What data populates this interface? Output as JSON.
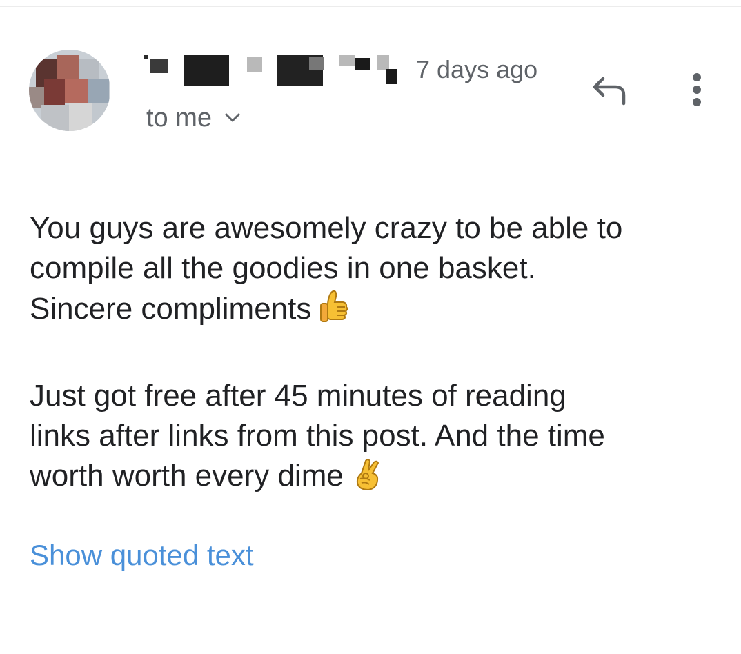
{
  "message": {
    "sender_name": "",
    "timestamp": "7 days ago",
    "recipient_label": "to me",
    "body_paragraphs": [
      {
        "lines": [
          "You guys are awesomely crazy to be able to",
          "compile all the goodies in one basket.",
          "Sincere compliments"
        ],
        "trailing_emoji": "thumbs-up-emoji"
      },
      {
        "lines": [
          "Just got free after 45 minutes of reading",
          "links after links from this post. And the time",
          "worth worth every dime"
        ],
        "trailing_emoji": "crossed-fingers-emoji"
      }
    ],
    "show_quoted_label": "Show quoted text"
  },
  "icons": {
    "reply": "reply-icon",
    "more": "more-vert-icon",
    "expand": "chevron-down-icon"
  },
  "colors": {
    "text": "#202124",
    "secondary_text": "#5f6368",
    "link": "#4a90d9",
    "icon": "#5f6368"
  }
}
